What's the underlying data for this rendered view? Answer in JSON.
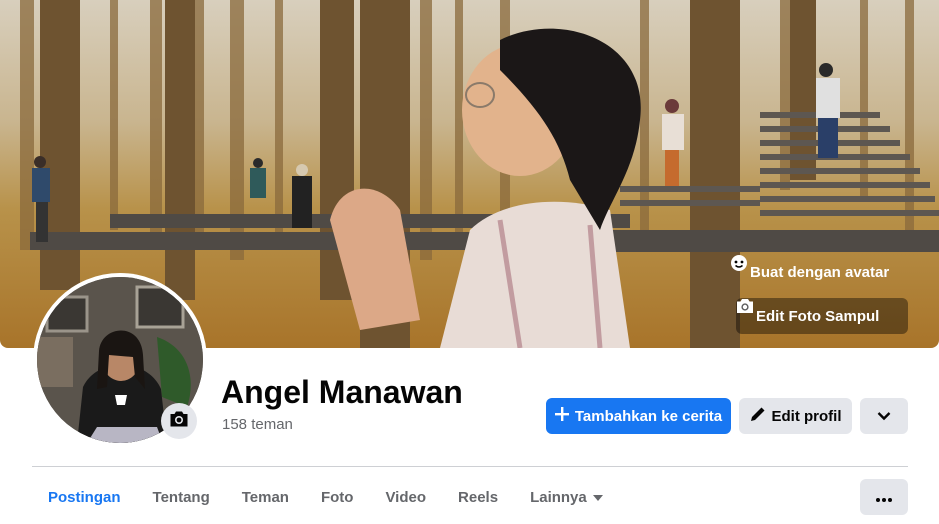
{
  "cover": {
    "avatar_button_label": "Buat dengan avatar",
    "edit_cover_label": "Edit Foto Sampul"
  },
  "profile": {
    "name": "Angel Manawan",
    "friends": "158 teman"
  },
  "actions": {
    "add_story": "Tambahkan ke cerita",
    "edit_profile": "Edit profil"
  },
  "tabs": [
    {
      "label": "Postingan",
      "active": true
    },
    {
      "label": "Tentang"
    },
    {
      "label": "Teman"
    },
    {
      "label": "Foto"
    },
    {
      "label": "Video"
    },
    {
      "label": "Reels"
    },
    {
      "label": "Lainnya"
    }
  ],
  "colors": {
    "accent": "#1877f2",
    "secondary_button": "#e4e6eb",
    "muted_text": "#65676b"
  },
  "icons": [
    "avatar-icon",
    "camera-icon",
    "plus-icon",
    "pencil-icon",
    "chevron-down-icon",
    "more-dots-icon"
  ]
}
